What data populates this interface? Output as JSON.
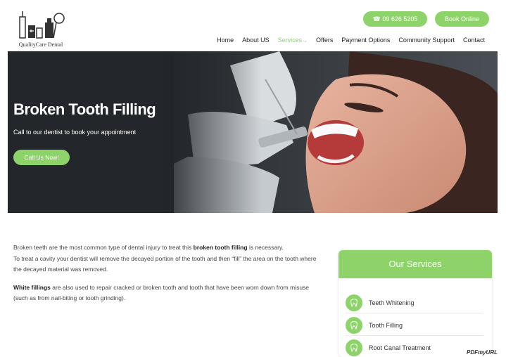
{
  "logo": {
    "text": "QualityCare Dental"
  },
  "header": {
    "phone_label": "09 626 5205",
    "book_label": "Book Online"
  },
  "nav": {
    "items": [
      "Home",
      "About US",
      "Services",
      "Offers",
      "Payment Options",
      "Community Support",
      "Contact"
    ],
    "active": "Services"
  },
  "hero": {
    "title": "Broken Tooth Filling",
    "subtitle": "Call to our dentist to book your appointment",
    "cta": "Call Us Now!"
  },
  "content": {
    "p1_a": "Broken teeth are the most common type of dental injury to treat this ",
    "p1_b": "broken tooth filling",
    "p1_c": " is necessary.",
    "p2": "To treat a cavity your dentist will remove the decayed portion of the tooth and then “fill” the area on the tooth where the decayed material was removed.",
    "p3_a": "White fillings",
    "p3_b": " are also used to repair cracked or broken tooth and tooth that have been worn down from misuse (such as from nail-biting or tooth grinding)."
  },
  "services": {
    "title": "Our Services",
    "items": [
      "Teeth Whitening",
      "Tooth Filling",
      "Root Canal Treatment"
    ]
  },
  "badge": {
    "text": "PDFmyURL"
  },
  "colors": {
    "accent": "#8dd36a"
  }
}
